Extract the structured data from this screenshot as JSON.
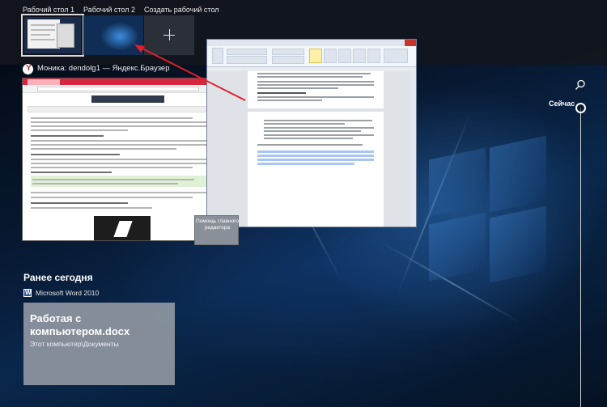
{
  "virtual_desktops": {
    "items": [
      {
        "label": "Рабочий стол 1",
        "active": true
      },
      {
        "label": "Рабочий стол 2",
        "active": false
      }
    ],
    "new_desktop_label": "Создать рабочий стол",
    "new_desktop_icon": "plus-icon"
  },
  "windows": {
    "browser_title": "Моника: dendolg1 — Яндекс.Браузер",
    "browser_icon": "yandex-browser-icon",
    "word_icon": "word-document-window",
    "help_thumb_label": "Помощь главного редактора"
  },
  "timeline": {
    "now_label": "Сейчас",
    "search_icon": "search-icon",
    "section_title": "Ранее сегодня",
    "activity": {
      "app_name": "Microsoft Word 2010",
      "app_icon": "word-icon",
      "document_title": "Работая с компьютером.docx",
      "document_path": "Этот компьютер\\Документы"
    }
  },
  "colors": {
    "accent_arrow": "#e0202a",
    "browser_tabbar": "#d7263d",
    "topbar": "#12161e"
  }
}
